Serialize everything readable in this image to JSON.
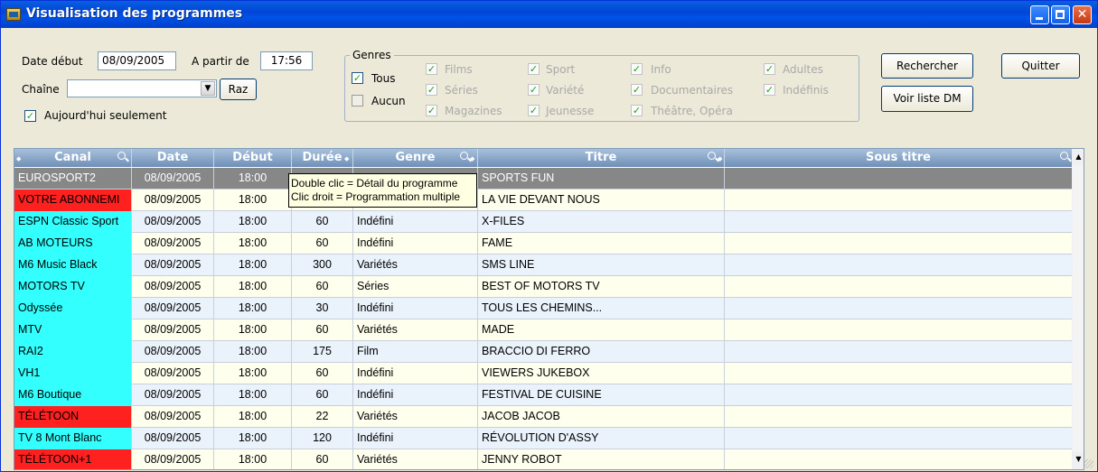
{
  "window": {
    "title": "Visualisation des programmes"
  },
  "filters": {
    "date_label": "Date début",
    "date_value": "08/09/2005",
    "from_label": "A partir de",
    "time_value": "17:56",
    "channel_label": "Chaîne",
    "channel_value": "",
    "raz_label": "Raz",
    "today_only_label": "Aujourd'hui seulement",
    "today_only_checked": true
  },
  "genres": {
    "title": "Genres",
    "all_label": "Tous",
    "none_label": "Aucun",
    "items": [
      {
        "label": "Films",
        "checked": true
      },
      {
        "label": "Séries",
        "checked": true
      },
      {
        "label": "Magazines",
        "checked": true
      },
      {
        "label": "Sport",
        "checked": true
      },
      {
        "label": "Variété",
        "checked": true
      },
      {
        "label": "Jeunesse",
        "checked": true
      },
      {
        "label": "Info",
        "checked": true
      },
      {
        "label": "Documentaires",
        "checked": true
      },
      {
        "label": "Théâtre, Opéra",
        "checked": true
      },
      {
        "label": "Adultes",
        "checked": true
      },
      {
        "label": "Indéfinis",
        "checked": true
      }
    ]
  },
  "buttons": {
    "search": "Rechercher",
    "quit": "Quitter",
    "dm_list": "Voir liste DM"
  },
  "tooltip": {
    "line1": "Double clic = Détail du programme",
    "line2": "Clic droit = Programmation multiple"
  },
  "grid": {
    "columns": [
      "Canal",
      "Date",
      "Début",
      "Durée",
      "Genre",
      "Titre",
      "Sous titre"
    ],
    "rows": [
      {
        "canal": "EUROSPORT2",
        "date": "08/09/2005",
        "debut": "18:00",
        "duree": "",
        "genre": "",
        "titre": "SPORTS FUN",
        "sous_titre": "",
        "highlight": "none",
        "selected": true
      },
      {
        "canal": "VOTRE ABONNEMI",
        "date": "08/09/2005",
        "debut": "18:00",
        "duree": "",
        "genre": "",
        "titre": "LA VIE DEVANT NOUS",
        "sous_titre": "",
        "highlight": "red"
      },
      {
        "canal": "ESPN Classic Sport",
        "date": "08/09/2005",
        "debut": "18:00",
        "duree": "60",
        "genre": "Indéfini",
        "titre": "X-FILES",
        "sous_titre": "",
        "highlight": "cyan"
      },
      {
        "canal": "AB MOTEURS",
        "date": "08/09/2005",
        "debut": "18:00",
        "duree": "60",
        "genre": "Indéfini",
        "titre": "FAME",
        "sous_titre": "",
        "highlight": "cyan"
      },
      {
        "canal": "M6 Music Black",
        "date": "08/09/2005",
        "debut": "18:00",
        "duree": "300",
        "genre": "Variétés",
        "titre": "SMS LINE",
        "sous_titre": "",
        "highlight": "cyan"
      },
      {
        "canal": "MOTORS TV",
        "date": "08/09/2005",
        "debut": "18:00",
        "duree": "60",
        "genre": "Séries",
        "titre": "BEST OF MOTORS TV",
        "sous_titre": "",
        "highlight": "cyan"
      },
      {
        "canal": "Odyssée",
        "date": "08/09/2005",
        "debut": "18:00",
        "duree": "30",
        "genre": "Indéfini",
        "titre": "TOUS LES CHEMINS...",
        "sous_titre": "",
        "highlight": "cyan"
      },
      {
        "canal": "MTV",
        "date": "08/09/2005",
        "debut": "18:00",
        "duree": "60",
        "genre": "Variétés",
        "titre": "MADE",
        "sous_titre": "",
        "highlight": "cyan"
      },
      {
        "canal": "RAI2",
        "date": "08/09/2005",
        "debut": "18:00",
        "duree": "175",
        "genre": "Film",
        "titre": "BRACCIO DI FERRO",
        "sous_titre": "",
        "highlight": "cyan"
      },
      {
        "canal": "VH1",
        "date": "08/09/2005",
        "debut": "18:00",
        "duree": "60",
        "genre": "Indéfini",
        "titre": "VIEWERS JUKEBOX",
        "sous_titre": "",
        "highlight": "cyan"
      },
      {
        "canal": "M6 Boutique",
        "date": "08/09/2005",
        "debut": "18:00",
        "duree": "60",
        "genre": "Indéfini",
        "titre": "FESTIVAL DE CUISINE",
        "sous_titre": "",
        "highlight": "cyan"
      },
      {
        "canal": "TÉLÉTOON",
        "date": "08/09/2005",
        "debut": "18:00",
        "duree": "22",
        "genre": "Variétés",
        "titre": "JACOB JACOB",
        "sous_titre": "",
        "highlight": "red"
      },
      {
        "canal": "TV 8 Mont Blanc",
        "date": "08/09/2005",
        "debut": "18:00",
        "duree": "120",
        "genre": "Indéfini",
        "titre": "RÉVOLUTION D'ASSY",
        "sous_titre": "",
        "highlight": "cyan"
      },
      {
        "canal": "TÉLÉTOON+1",
        "date": "08/09/2005",
        "debut": "18:00",
        "duree": "60",
        "genre": "Variétés",
        "titre": "JENNY ROBOT",
        "sous_titre": "",
        "highlight": "red"
      }
    ]
  },
  "colors": {
    "cyan_channel": "#33ffff",
    "red_channel": "#ff2020",
    "row_even": "#ffffee",
    "row_odd": "#eaf2fb",
    "selected_row": "#878787"
  }
}
